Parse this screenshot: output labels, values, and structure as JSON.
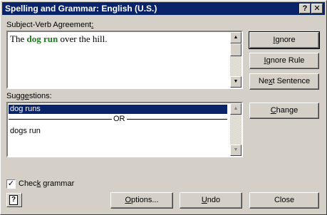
{
  "window": {
    "title": "Spelling and Grammar: English (U.S.)",
    "help_glyph": "?",
    "close_glyph": "✕"
  },
  "error_section": {
    "label_before": "Subject-Verb Agreement",
    "label_underlined": ":",
    "sentence_before": "The ",
    "sentence_error": "dog run",
    "sentence_after": " over the hill."
  },
  "buttons": {
    "ignore": {
      "ul": "I",
      "rest": "gnore"
    },
    "ignore_rule": {
      "ul": "I",
      "rest": "gnore Rule"
    },
    "next_sentence": {
      "before": "Ne",
      "ul": "x",
      "rest": "t Sentence"
    },
    "change": {
      "ul": "C",
      "rest": "hange"
    },
    "options": {
      "ul": "O",
      "rest": "ptions..."
    },
    "undo": {
      "ul": "U",
      "rest": "ndo"
    },
    "close": "Close"
  },
  "suggestions": {
    "label_before": "Sugg",
    "label_ul": "e",
    "label_after": "stions:",
    "items": [
      "dog runs",
      "OR",
      "dogs run"
    ],
    "selected_index": 0
  },
  "check_grammar": {
    "label_before": "Chec",
    "label_ul": "k",
    "label_after": " grammar",
    "checked": true,
    "mark": "✓"
  },
  "scroll_glyphs": {
    "up": "▲",
    "down": "▼"
  },
  "help_button_glyph": "?"
}
